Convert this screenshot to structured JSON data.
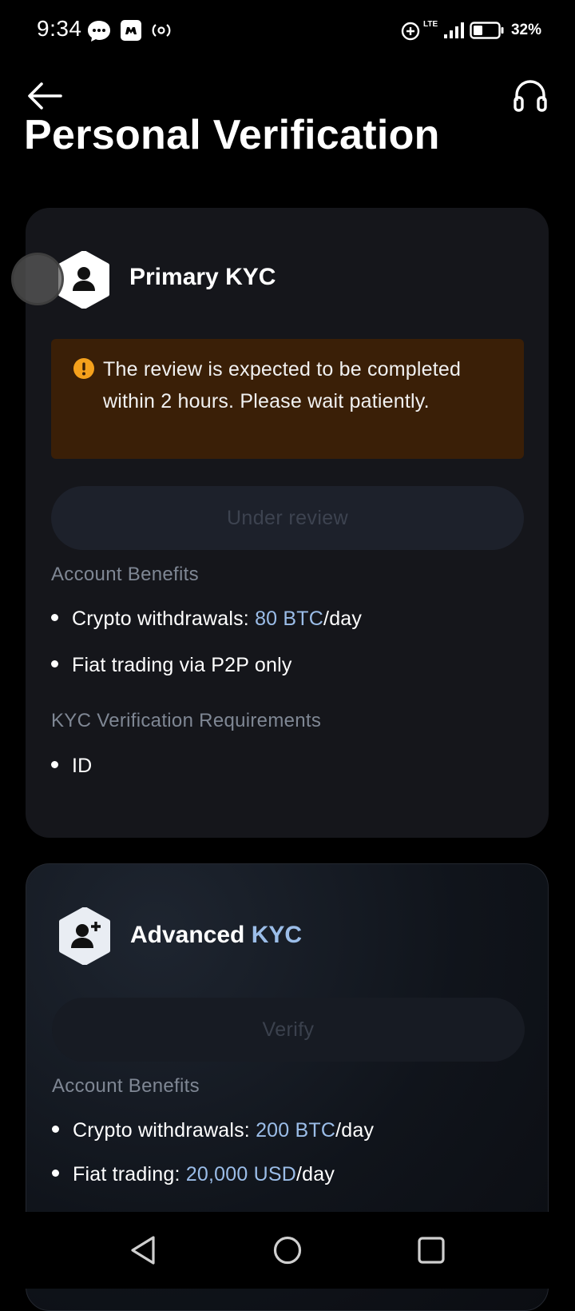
{
  "status_bar": {
    "time": "9:34",
    "battery": "32%",
    "network": "LTE",
    "icons": [
      "message-icon",
      "game-controller-icon",
      "hotspot-icon",
      "data-saver-icon",
      "lte-icon",
      "signal-icon",
      "battery-icon"
    ]
  },
  "header": {
    "title": "Personal Verification",
    "back_icon": "arrow-left-icon",
    "support_icon": "headset-icon"
  },
  "primary_kyc": {
    "title": "Primary KYC",
    "notice": "The review is expected to be completed within 2 hours. Please wait patiently.",
    "button": "Under review",
    "benefits_label": "Account Benefits",
    "benefit_1_prefix": "Crypto withdrawals: ",
    "benefit_1_value": "80 BTC",
    "benefit_1_suffix": "/day",
    "benefit_2": "Fiat trading via P2P only",
    "requirements_label": "KYC Verification Requirements",
    "requirement_1": "ID"
  },
  "advanced_kyc": {
    "title_part1": "Advanced",
    "title_part2": "KYC",
    "button": "Verify",
    "benefits_label": "Account Benefits",
    "benefit_1_prefix": "Crypto withdrawals: ",
    "benefit_1_value": "200 BTC",
    "benefit_1_suffix": "/day",
    "benefit_2_prefix": "Fiat trading: ",
    "benefit_2_value": "20,000 USD",
    "benefit_2_suffix": "/day"
  },
  "colors": {
    "background": "#000000",
    "card": "#15161b",
    "accent": "#9bbde8",
    "warning": "#f5a11c",
    "notice_bg": "#3a1f07"
  }
}
